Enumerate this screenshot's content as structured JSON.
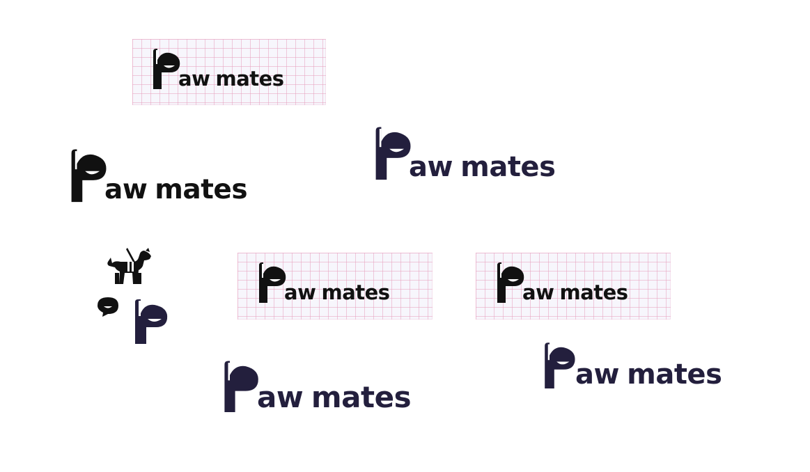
{
  "brand": {
    "wordmark_rest": "aw",
    "wordmark_second": "mates",
    "colors": {
      "black": "#111111",
      "navy": "#231f3d",
      "grid_bg": "#f7f6fc",
      "grid_line": "#e8a0be"
    }
  },
  "icons": {
    "dog": "dog-with-harness-icon",
    "speech": "speech-bubble-icon",
    "p_mark": "p-letter-mark-icon"
  }
}
